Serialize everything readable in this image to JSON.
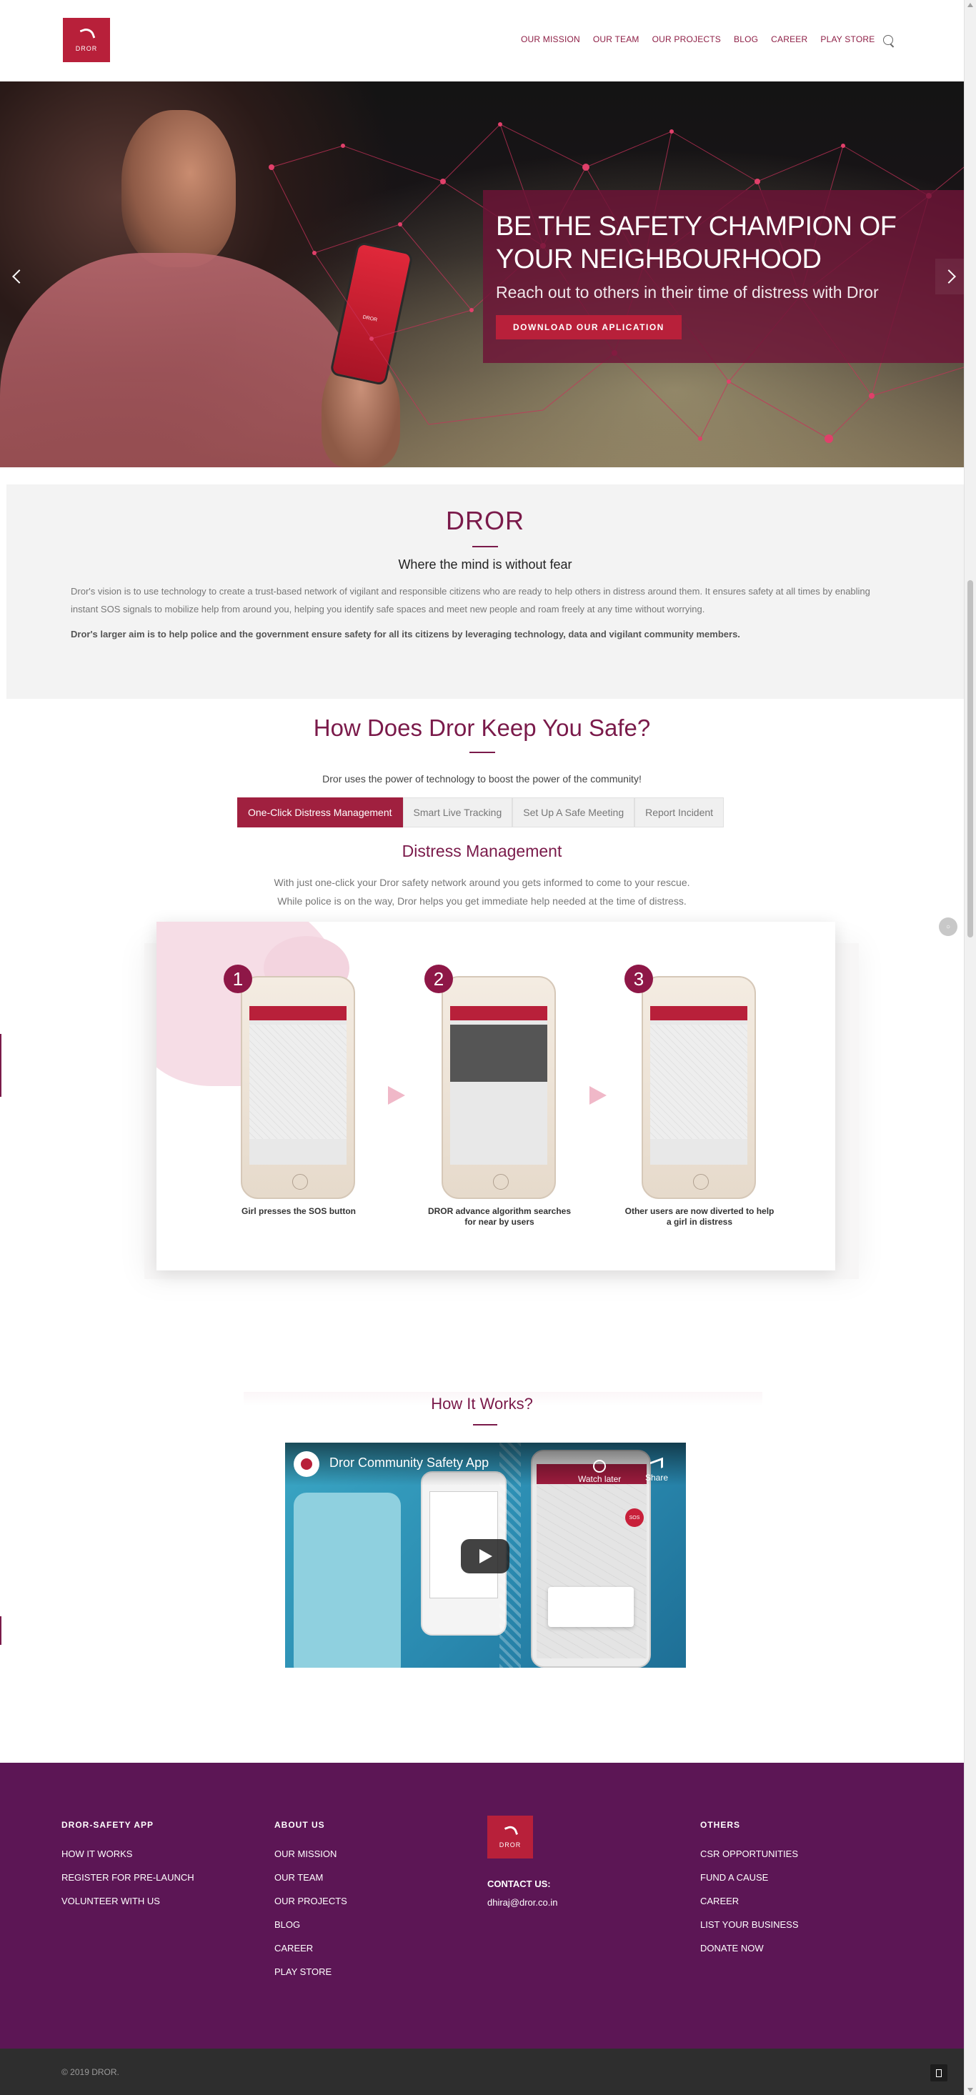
{
  "brand": {
    "logo_text": "DROR",
    "primary": "#b8203a",
    "accent": "#7a1a4a",
    "footer_bg": "#5c1655"
  },
  "nav": {
    "items": [
      "OUR MISSION",
      "OUR TEAM",
      "OUR PROJECTS",
      "BLOG",
      "CAREER",
      "PLAY STORE"
    ],
    "search_icon": "search-icon"
  },
  "hero": {
    "title": "BE THE SAFETY CHAMPION OF YOUR NEIGHBOURHOOD",
    "subtitle": "Reach out to others in their time of distress with Dror",
    "button": "DOWNLOAD OUR APLICATION",
    "phone_label": "DROR"
  },
  "about": {
    "title": "DROR",
    "tagline": "Where the mind is without fear",
    "para1": "Dror's vision is to use technology to create a trust-based network of vigilant and responsible citizens who are ready to help others in distress around them. It ensures safety at all times by enabling instant SOS signals to mobilize help from around you, helping you identify safe spaces and meet new people and roam freely at any time without worrying.",
    "para2": "Dror's larger aim is to help police and the government ensure safety for all its citizens by leveraging technology, data and vigilant community members."
  },
  "safety": {
    "title": "How Does Dror Keep You Safe?",
    "lead": "Dror uses the power of technology to boost the power of the community!",
    "tabs": [
      "One-Click Distress Management",
      "Smart Live Tracking",
      "Set Up A Safe Meeting",
      "Report Incident"
    ],
    "active_tab": 0,
    "section_title": "Distress Management",
    "desc_line1": "With just one-click your Dror safety network around you gets informed to come to your rescue.",
    "desc_line2": "While police is on the way, Dror helps you get immediate help needed at the time of distress.",
    "steps": [
      {
        "num": "1",
        "caption": "Girl presses the SOS button"
      },
      {
        "num": "2",
        "caption": "DROR advance algorithm searches for near by users"
      },
      {
        "num": "3",
        "caption": "Other users are now diverted to help a girl in distress"
      }
    ]
  },
  "works": {
    "title": "How It Works?",
    "video_title": "Dror Community Safety App",
    "watch_later": "Watch later",
    "share": "Share"
  },
  "footer": {
    "col1": {
      "title": "DROR-SAFETY APP",
      "links": [
        "HOW IT WORKS",
        "REGISTER FOR PRE-LAUNCH",
        "VOLUNTEER WITH US"
      ]
    },
    "col2": {
      "title": "ABOUT US",
      "links": [
        "OUR MISSION",
        "OUR TEAM",
        "OUR PROJECTS",
        "BLOG",
        "CAREER",
        "PLAY STORE"
      ]
    },
    "col3": {
      "logo_text": "DROR",
      "contact_label": "CONTACT US:",
      "email": "dhiraj@dror.co.in"
    },
    "col4": {
      "title": "OTHERS",
      "links": [
        "CSR OPPORTUNITIES",
        "FUND A CAUSE",
        "CAREER",
        "LIST YOUR BUSINESS",
        "DONATE NOW"
      ]
    },
    "copyright": "© 2019 DROR."
  }
}
